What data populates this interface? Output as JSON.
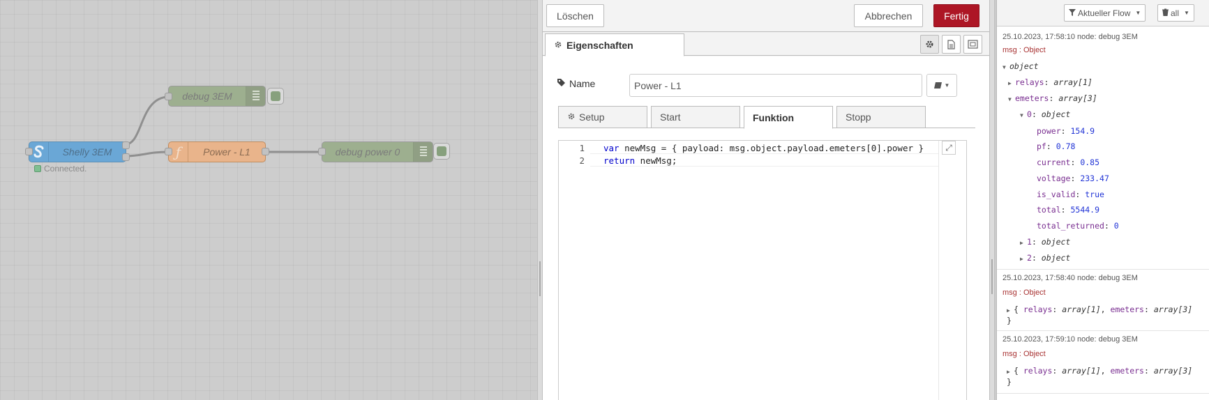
{
  "workspace": {
    "nodes": {
      "debug_3em": "debug 3EM",
      "shelly": "Shelly 3EM",
      "function": "Power - L1",
      "debug_power": "debug power 0"
    },
    "status_text": "Connected."
  },
  "editor": {
    "delete_label": "Löschen",
    "cancel_label": "Abbrechen",
    "done_label": "Fertig",
    "tab_properties": "Eigenschaften",
    "name_label": "Name",
    "name_value": "Power - L1",
    "function_tabs": [
      "Setup",
      "Start",
      "Funktion",
      "Stopp"
    ],
    "code_lines": [
      {
        "num": "1",
        "kw": "var",
        "rest": " newMsg = { payload: msg.object.payload.emeters[0].power }"
      },
      {
        "num": "2",
        "kw": "return",
        "rest": " newMsg;"
      }
    ],
    "colors": {
      "done": "#ad1625"
    }
  },
  "sidebar": {
    "filter_label": "Aktueller Flow",
    "clear_label": "all",
    "messages": [
      {
        "meta": "25.10.2023, 17:58:10   node: debug 3EM",
        "topic": "msg : Object",
        "tree": {
          "root": "object",
          "relays_key": "relays",
          "relays_type": "array[1]",
          "emeters_key": "emeters",
          "emeters_type": "array[3]",
          "item0_key": "0",
          "item0_type": "object",
          "fields": [
            {
              "key": "power",
              "value": "154.9"
            },
            {
              "key": "pf",
              "value": "0.78"
            },
            {
              "key": "current",
              "value": "0.85"
            },
            {
              "key": "voltage",
              "value": "233.47"
            },
            {
              "key": "is_valid",
              "value": "true"
            },
            {
              "key": "total",
              "value": "5544.9"
            },
            {
              "key": "total_returned",
              "value": "0"
            }
          ],
          "item1_key": "1",
          "item1_type": "object",
          "item2_key": "2",
          "item2_type": "object"
        }
      },
      {
        "meta": "25.10.2023, 17:58:40   node: debug 3EM",
        "topic": "msg : Object",
        "summary_open": "{ ",
        "relays_key": "relays",
        "relays_type": "array[1]",
        "emeters_key": "emeters",
        "emeters_type": "array[3]",
        "summary_close": "}"
      },
      {
        "meta": "25.10.2023, 17:59:10   node: debug 3EM",
        "topic": "msg : Object",
        "summary_open": "{ ",
        "relays_key": "relays",
        "relays_type": "array[1]",
        "emeters_key": "emeters",
        "emeters_type": "array[3]",
        "summary_close": "}"
      }
    ]
  },
  "icons": [
    "gear-icon",
    "document-icon",
    "frame-icon",
    "tag-icon",
    "book-icon",
    "filter-icon",
    "trash-icon",
    "expand-icon",
    "function-icon",
    "shelly-icon"
  ]
}
